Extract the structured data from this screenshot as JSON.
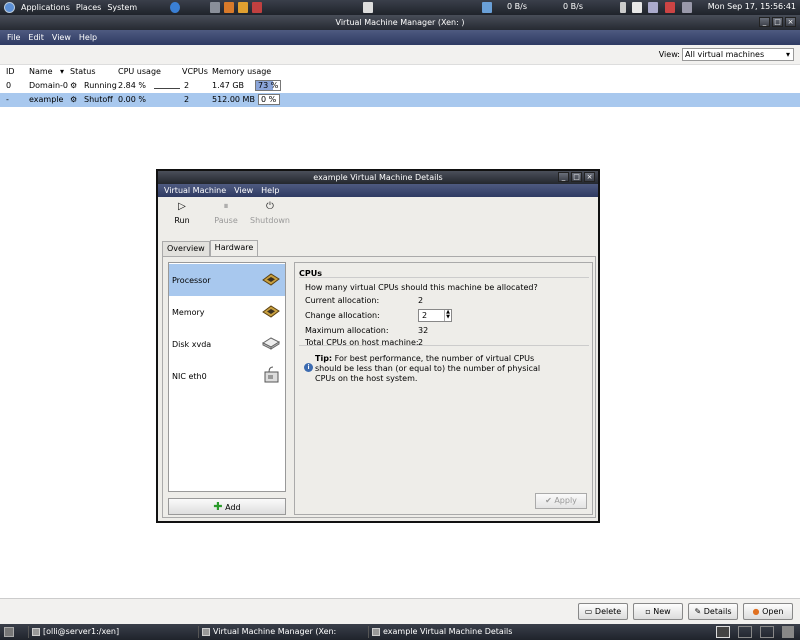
{
  "top_panel": {
    "menu": [
      "Applications",
      "Places",
      "System"
    ],
    "net_down": "0 B/s",
    "net_up": "0 B/s",
    "clock": "Mon Sep 17, 15:56:41"
  },
  "main_window": {
    "title": "Virtual Machine Manager (Xen:                              )",
    "menu": [
      "File",
      "Edit",
      "View",
      "Help"
    ],
    "view_label": "View:",
    "view_select": "All virtual machines",
    "columns": [
      "ID",
      "Name",
      "Status",
      "CPU usage",
      "VCPUs",
      "Memory usage"
    ],
    "rows": [
      {
        "id": "0",
        "name": "Domain-0",
        "status": "Running",
        "cpu": "2.84 %",
        "vcpus": "2",
        "mem": "1.47 GB",
        "mem_pct": "73 %"
      },
      {
        "id": "-",
        "name": "example",
        "status": "Shutoff",
        "cpu": "0.00 %",
        "vcpus": "2",
        "mem": "512.00 MB",
        "mem_pct": "0 %"
      }
    ],
    "buttons": {
      "delete": "Delete",
      "new": "New",
      "details": "Details",
      "open": "Open"
    }
  },
  "taskbar": {
    "tasks": [
      "[olli@server1:/xen]",
      "Virtual Machine Manager (Xen: serv...",
      "example Virtual Machine Details"
    ]
  },
  "dialog": {
    "title": "example Virtual Machine Details",
    "menu": [
      "Virtual Machine",
      "View",
      "Help"
    ],
    "tools": {
      "run": "Run",
      "pause": "Pause",
      "shutdown": "Shutdown"
    },
    "tabs": [
      "Overview",
      "Hardware"
    ],
    "hardware": [
      "Processor",
      "Memory",
      "Disk xvda",
      "NIC eth0"
    ],
    "add_label": "Add",
    "section": "CPUs",
    "question": "How many virtual CPUs should this machine be allocated?",
    "current_label": "Current allocation:",
    "current_value": "2",
    "change_label": "Change allocation:",
    "change_value": "2",
    "max_label": "Maximum allocation:",
    "max_value": "32",
    "total_label": "Total CPUs on host machine:",
    "total_value": "2",
    "tip_bold": "Tip:",
    "tip_text": "For best performance, the number of virtual CPUs should be less than (or equal to) the number of physical CPUs on the host system.",
    "apply": "Apply"
  }
}
